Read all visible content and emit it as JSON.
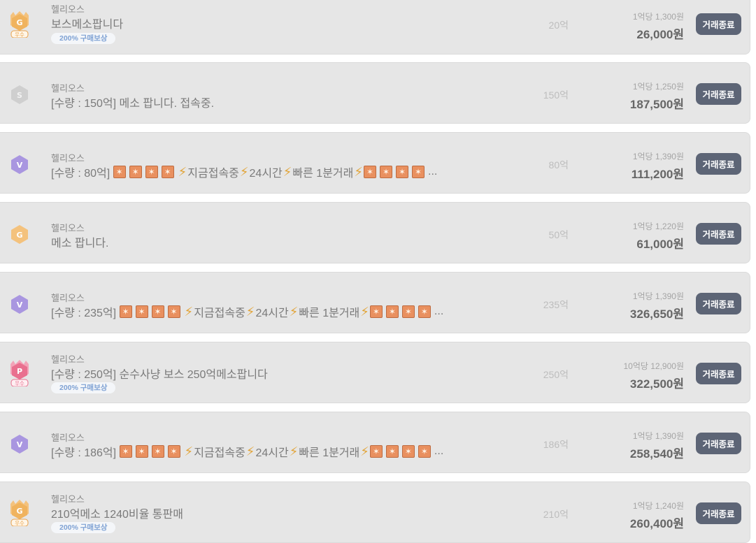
{
  "server_name": "헬리오스",
  "action_label": "거래종료",
  "reward_tag": "200% 구매보상",
  "ellipsis": "...",
  "colors": {
    "button_bg": "#5d6576",
    "row_bg": "#e6e6e6",
    "tag_text": "#7fa2d4"
  },
  "rows": [
    {
      "badge": "gold-g-excellent-badge",
      "badge_letter": "G",
      "badge_sub": "우수",
      "title": "보스메소팝니다",
      "has_tag": true,
      "qty": "20억",
      "unit_price": "1억당 1,300원",
      "total": "26,000원"
    },
    {
      "badge": "silver-s-badge",
      "badge_letter": "S",
      "title": "[수량 : 150억] 메소 팝니다. 접속중.",
      "has_tag": false,
      "qty": "150억",
      "unit_price": "1억당 1,250원",
      "total": "187,500원"
    },
    {
      "badge": "purple-v-badge",
      "badge_letter": "V",
      "title_prefix": "[수량 : 80억]",
      "title_segments": [
        "지금접속중",
        "24시간",
        "빠른 1분거래"
      ],
      "has_tag": false,
      "qty": "80억",
      "unit_price": "1억당 1,390원",
      "total": "111,200원"
    },
    {
      "badge": "gold-g-badge",
      "badge_letter": "G",
      "title": "메소 팝니다.",
      "has_tag": false,
      "qty": "50억",
      "unit_price": "1억당 1,220원",
      "total": "61,000원"
    },
    {
      "badge": "purple-v-badge",
      "badge_letter": "V",
      "title_prefix": "[수량 : 235억]",
      "title_segments": [
        "지금접속중",
        "24시간",
        "빠른 1분거래"
      ],
      "has_tag": false,
      "qty": "235억",
      "unit_price": "1억당 1,390원",
      "total": "326,650원"
    },
    {
      "badge": "pink-p-excellent-badge",
      "badge_letter": "P",
      "badge_sub": "우수",
      "title": "[수량 : 250억] 순수사냥 보스 250억메소팝니다",
      "has_tag": true,
      "qty": "250억",
      "unit_price": "10억당 12,900원",
      "total": "322,500원"
    },
    {
      "badge": "purple-v-badge",
      "badge_letter": "V",
      "title_prefix": "[수량 : 186억]",
      "title_segments": [
        "지금접속중",
        "24시간",
        "빠른 1분거래"
      ],
      "has_tag": false,
      "qty": "186억",
      "unit_price": "1억당 1,390원",
      "total": "258,540원"
    },
    {
      "badge": "gold-g-excellent-badge",
      "badge_letter": "G",
      "badge_sub": "우수",
      "title": "210억메소 1240비율 통판매",
      "has_tag": true,
      "qty": "210억",
      "unit_price": "1억당 1,240원",
      "total": "260,400원"
    }
  ]
}
